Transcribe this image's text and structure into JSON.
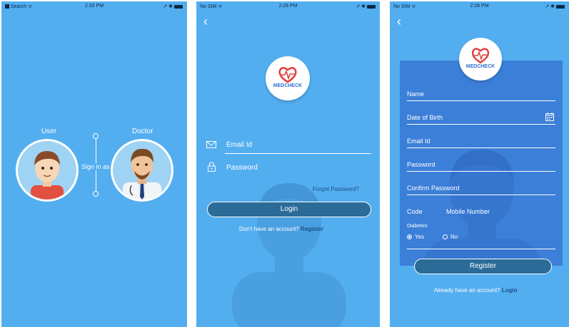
{
  "screen1": {
    "status": {
      "carrier": "Search",
      "time": "2:33 PM"
    },
    "user_label": "User",
    "doctor_label": "Doctor",
    "sign_in_as": "Sign in as"
  },
  "screen2": {
    "status": {
      "carrier": "No SIM",
      "time": "2:28 PM"
    },
    "logo_text": "MEDCHECK",
    "email_placeholder": "Email Id",
    "password_placeholder": "Password",
    "forgot_password": "Forgot Password?",
    "login_button": "Login",
    "no_account_text": "Don't have an account?",
    "register_link": "Register"
  },
  "screen3": {
    "status": {
      "carrier": "No SIM",
      "time": "2:28 PM"
    },
    "logo_text": "MEDCHECK",
    "fields": {
      "name": "Name",
      "dob": "Date of Birth",
      "email": "Email Id",
      "password": "Password",
      "confirm_password": "Confirm Password",
      "code": "Code",
      "mobile": "Mobile Number"
    },
    "diabetics_label": "Diabetics",
    "yes_label": "Yes",
    "no_label": "No",
    "register_button": "Register",
    "have_account_text": "Already have an account?",
    "login_link": "Login"
  },
  "colors": {
    "background": "#53aef0",
    "card": "#3b7fd8",
    "button": "#2a6b97",
    "logo_text": "#2f6fce",
    "link": "#1a4f82"
  }
}
